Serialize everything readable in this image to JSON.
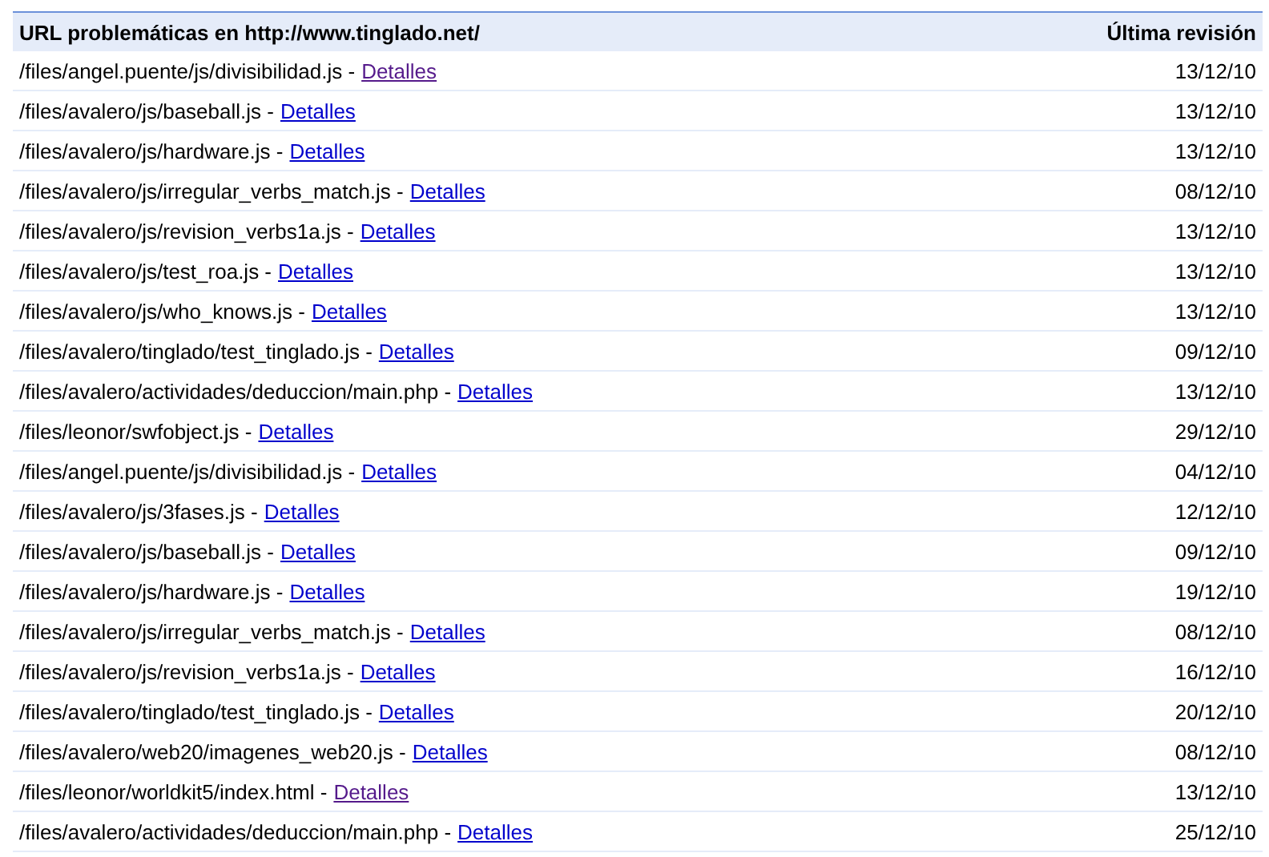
{
  "table": {
    "columns": [
      "URL problemáticas en http://www.tinglado.net/",
      "Última revisión"
    ],
    "rows": [
      {
        "path": "/files/angel.puente/js/divisibilidad.js -",
        "link": {
          "label": "Detalles",
          "visited": true
        },
        "date": "13/12/10"
      },
      {
        "path": "/files/avalero/js/baseball.js -",
        "link": {
          "label": "Detalles",
          "visited": false
        },
        "date": "13/12/10"
      },
      {
        "path": "/files/avalero/js/hardware.js -",
        "link": {
          "label": "Detalles",
          "visited": false
        },
        "date": "13/12/10"
      },
      {
        "path": "/files/avalero/js/irregular_verbs_match.js -",
        "link": {
          "label": "Detalles",
          "visited": false
        },
        "date": "08/12/10"
      },
      {
        "path": "/files/avalero/js/revision_verbs1a.js -",
        "link": {
          "label": "Detalles",
          "visited": false
        },
        "date": "13/12/10"
      },
      {
        "path": "/files/avalero/js/test_roa.js -",
        "link": {
          "label": "Detalles",
          "visited": false
        },
        "date": "13/12/10"
      },
      {
        "path": "/files/avalero/js/who_knows.js -",
        "link": {
          "label": "Detalles",
          "visited": false
        },
        "date": "13/12/10"
      },
      {
        "path": "/files/avalero/tinglado/test_tinglado.js -",
        "link": {
          "label": "Detalles",
          "visited": false
        },
        "date": "09/12/10"
      },
      {
        "path": "/files/avalero/actividades/deduccion/main.php -",
        "link": {
          "label": "Detalles",
          "visited": false
        },
        "date": "13/12/10"
      },
      {
        "path": "/files/leonor/swfobject.js -",
        "link": {
          "label": "Detalles",
          "visited": false
        },
        "date": "29/12/10"
      },
      {
        "path": "/files/angel.puente/js/divisibilidad.js -",
        "link": {
          "label": "Detalles",
          "visited": false
        },
        "date": "04/12/10"
      },
      {
        "path": "/files/avalero/js/3fases.js -",
        "link": {
          "label": "Detalles",
          "visited": false
        },
        "date": "12/12/10"
      },
      {
        "path": "/files/avalero/js/baseball.js -",
        "link": {
          "label": "Detalles",
          "visited": false
        },
        "date": "09/12/10"
      },
      {
        "path": "/files/avalero/js/hardware.js -",
        "link": {
          "label": "Detalles",
          "visited": false
        },
        "date": "19/12/10"
      },
      {
        "path": "/files/avalero/js/irregular_verbs_match.js -",
        "link": {
          "label": "Detalles",
          "visited": false
        },
        "date": "08/12/10"
      },
      {
        "path": "/files/avalero/js/revision_verbs1a.js -",
        "link": {
          "label": "Detalles",
          "visited": false
        },
        "date": "16/12/10"
      },
      {
        "path": "/files/avalero/tinglado/test_tinglado.js -",
        "link": {
          "label": "Detalles",
          "visited": false
        },
        "date": "20/12/10"
      },
      {
        "path": "/files/avalero/web20/imagenes_web20.js -",
        "link": {
          "label": "Detalles",
          "visited": false
        },
        "date": "08/12/10"
      },
      {
        "path": "/files/leonor/worldkit5/index.html -",
        "link": {
          "label": "Detalles",
          "visited": true
        },
        "date": "13/12/10"
      },
      {
        "path": "/files/avalero/actividades/deduccion/main.php -",
        "link": {
          "label": "Detalles",
          "visited": false
        },
        "date": "25/12/10"
      }
    ]
  }
}
